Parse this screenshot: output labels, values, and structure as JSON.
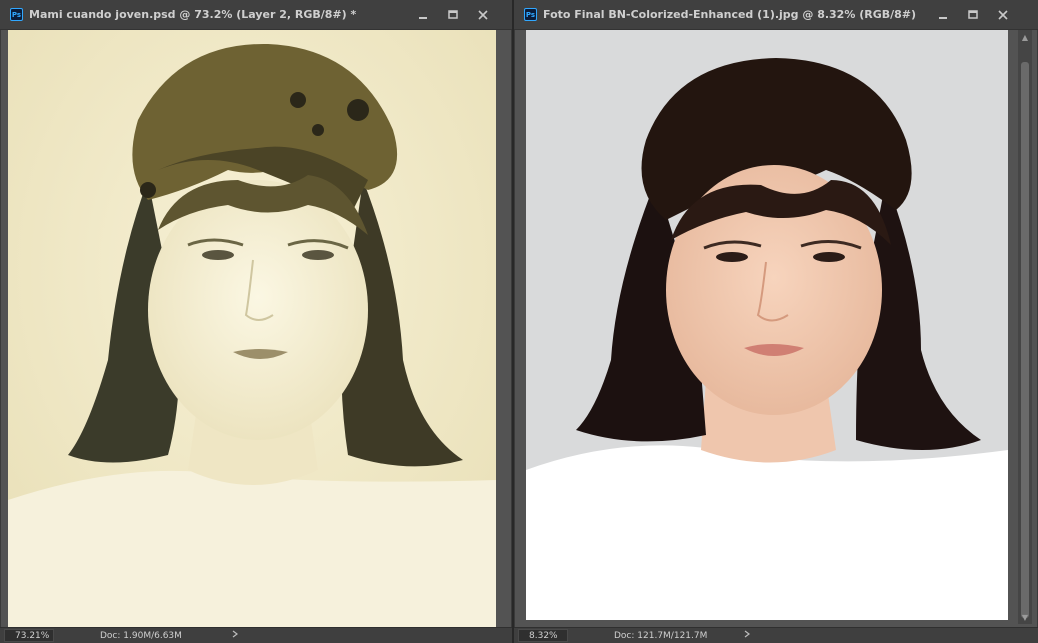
{
  "left_window": {
    "title": "Mami cuando joven.psd @ 73.2% (Layer 2, RGB/8#) *",
    "app_icon": "Ps",
    "zoom": "73.21%",
    "doc_info": "Doc: 1.90M/6.63M"
  },
  "right_window": {
    "title": "Foto Final BN-Colorized-Enhanced (1).jpg @ 8.32% (RGB/8#)",
    "app_icon": "Ps",
    "zoom": "8.32%",
    "doc_info": "Doc: 121.7M/121.7M"
  },
  "icons": {
    "minimize": "minimize-icon",
    "maximize": "maximize-icon",
    "close": "close-icon",
    "status_arrow": "chevron-right-icon"
  },
  "colors": {
    "workspace_bg": "#535353",
    "titlebar_bg": "#404040",
    "ps_accent": "#31a8ff"
  }
}
